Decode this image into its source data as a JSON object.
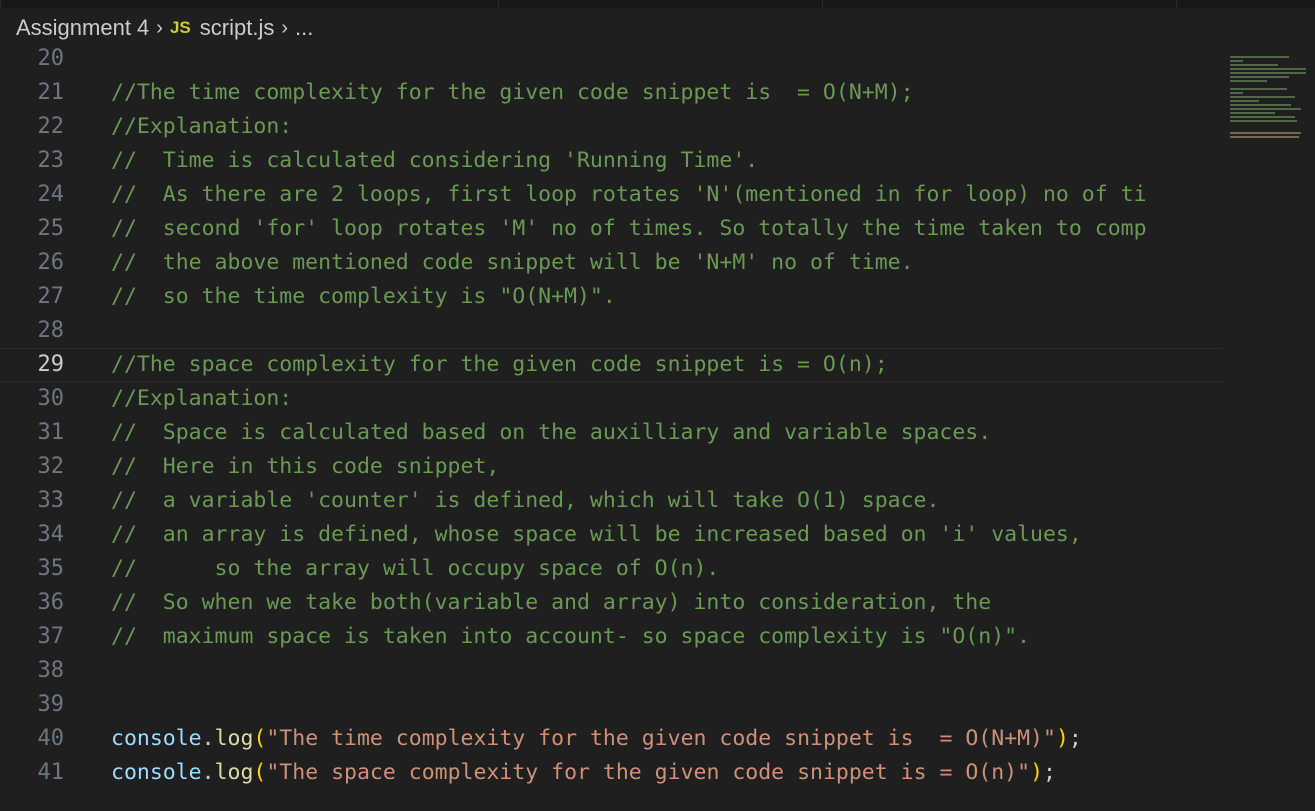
{
  "breadcrumb": {
    "folder": "Assignment 4",
    "file_icon": "JS",
    "file": "script.js",
    "symbol": "...",
    "separator": "›"
  },
  "editor": {
    "current_line": 29,
    "lines": [
      {
        "num": "20",
        "text": "",
        "kind": "blank"
      },
      {
        "num": "21",
        "text": "//The time complexity for the given code snippet is  = O(N+M);",
        "kind": "comment"
      },
      {
        "num": "22",
        "text": "//Explanation:",
        "kind": "comment"
      },
      {
        "num": "23",
        "text": "//  Time is calculated considering 'Running Time'.",
        "kind": "comment"
      },
      {
        "num": "24",
        "text": "//  As there are 2 loops, first loop rotates 'N'(mentioned in for loop) no of ti",
        "kind": "comment"
      },
      {
        "num": "25",
        "text": "//  second 'for' loop rotates 'M' no of times. So totally the time taken to comp",
        "kind": "comment"
      },
      {
        "num": "26",
        "text": "//  the above mentioned code snippet will be 'N+M' no of time.",
        "kind": "comment"
      },
      {
        "num": "27",
        "text": "//  so the time complexity is \"O(N+M)\".",
        "kind": "comment"
      },
      {
        "num": "28",
        "text": "",
        "kind": "blank"
      },
      {
        "num": "29",
        "text": "//The space complexity for the given code snippet is = O(n);",
        "kind": "comment"
      },
      {
        "num": "30",
        "text": "//Explanation:",
        "kind": "comment"
      },
      {
        "num": "31",
        "text": "//  Space is calculated based on the auxilliary and variable spaces.",
        "kind": "comment"
      },
      {
        "num": "32",
        "text": "//  Here in this code snippet,",
        "kind": "comment"
      },
      {
        "num": "33",
        "text": "//  a variable 'counter' is defined, which will take O(1) space.",
        "kind": "comment"
      },
      {
        "num": "34",
        "text": "//  an array is defined, whose space will be increased based on 'i' values,",
        "kind": "comment"
      },
      {
        "num": "35",
        "text": "//      so the array will occupy space of O(n).",
        "kind": "comment"
      },
      {
        "num": "36",
        "text": "//  So when we take both(variable and array) into consideration, the",
        "kind": "comment"
      },
      {
        "num": "37",
        "text": "//  maximum space is taken into account- so space complexity is \"O(n)\".",
        "kind": "comment"
      },
      {
        "num": "38",
        "text": "",
        "kind": "blank"
      },
      {
        "num": "39",
        "text": "",
        "kind": "blank"
      },
      {
        "num": "40",
        "kind": "call",
        "obj": "console",
        "dot": ".",
        "method": "log",
        "open": "(",
        "str": "\"The time complexity for the given code snippet is  = O(N+M)\"",
        "close": ")",
        "semi": ";"
      },
      {
        "num": "41",
        "kind": "call",
        "obj": "console",
        "dot": ".",
        "method": "log",
        "open": "(",
        "str": "\"The space complexity for the given code snippet is = O(n)\"",
        "close": ")",
        "semi": ";"
      }
    ]
  },
  "colors": {
    "background": "#1f1f1f",
    "comment": "#6a9955",
    "string": "#ce9178",
    "variable": "#9cdcfe",
    "function": "#dcdcaa",
    "bracket": "#ffd700",
    "line_number": "#6e7681",
    "js_icon": "#cbcb41"
  }
}
